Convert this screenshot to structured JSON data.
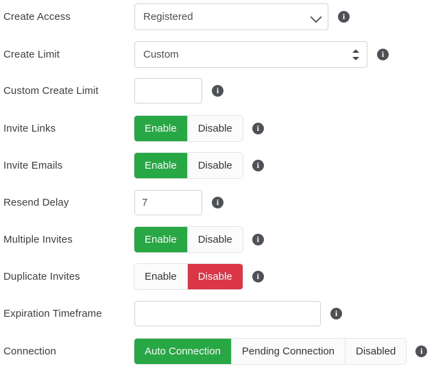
{
  "form": {
    "rows": [
      {
        "label": "Create Access",
        "type": "select",
        "value": "Registered",
        "icon": "chevron-down-icon",
        "info": "i"
      },
      {
        "label": "Create Limit",
        "type": "select",
        "value": "Custom",
        "icon": "spinner-arrows-icon",
        "info": "i"
      },
      {
        "label": "Custom Create Limit",
        "type": "text",
        "value": "",
        "placeholder": "",
        "info": "i"
      },
      {
        "label": "Invite Links",
        "type": "buttons",
        "options": [
          "Enable",
          "Disable"
        ],
        "selected": "Enable",
        "selected_color": "#28a745",
        "info": "i"
      },
      {
        "label": "Invite Emails",
        "type": "buttons",
        "options": [
          "Enable",
          "Disable"
        ],
        "selected": "Enable",
        "selected_color": "#28a745",
        "info": "i"
      },
      {
        "label": "Resend Delay",
        "type": "text",
        "value": "7",
        "placeholder": "",
        "info": "i"
      },
      {
        "label": "Multiple Invites",
        "type": "buttons",
        "options": [
          "Enable",
          "Disable"
        ],
        "selected": "Enable",
        "selected_color": "#28a745",
        "info": "i"
      },
      {
        "label": "Duplicate Invites",
        "type": "buttons",
        "options": [
          "Enable",
          "Disable"
        ],
        "selected": "Disable",
        "selected_color": "#dc3545",
        "info": "i"
      },
      {
        "label": "Expiration Timeframe",
        "type": "text",
        "value": "",
        "placeholder": "",
        "info": "i"
      },
      {
        "label": "Connection",
        "type": "buttons",
        "options": [
          "Auto Connection",
          "Pending Connection",
          "Disabled"
        ],
        "selected": "Auto Connection",
        "selected_color": "#28a745",
        "info": "i"
      }
    ]
  }
}
